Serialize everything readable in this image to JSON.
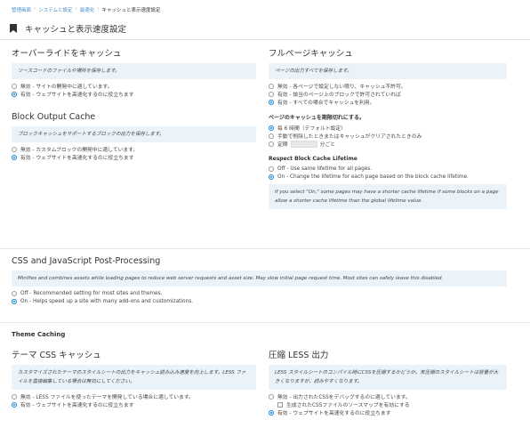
{
  "breadcrumb": {
    "items": [
      "管理画面",
      "システムと設定",
      "最適化"
    ],
    "current": "キャッシュと表示速度設定",
    "separator": "›"
  },
  "header": {
    "title": "キャッシュと表示速度設定",
    "icon": "bookmark-icon"
  },
  "override_cache": {
    "title": "オーバーライドをキャッシュ",
    "help": "ソースコードのファイルや場所を保存します。",
    "options": [
      {
        "label": "無効 - サイトの開発中に適しています。",
        "selected": false
      },
      {
        "label": "有効 - ウェブサイトを高速化するのに役立ちます",
        "selected": true
      }
    ]
  },
  "block_output": {
    "title": "Block Output Cache",
    "help": "ブロックキャッシュをサポートするブロックの出力を保存します。",
    "options": [
      {
        "label": "無効 - カスタムブロックの開発中に適しています。",
        "selected": false
      },
      {
        "label": "有効 - ウェブサイトを高速化するのに役立ちます",
        "selected": true
      }
    ]
  },
  "full_page": {
    "title": "フルページキャッシュ",
    "help": "ページの出力すべてを保存します。",
    "options": [
      {
        "label": "無効 - 各ページで設定しない限り、キャッシュ不許可。",
        "selected": false
      },
      {
        "label": "有効 - 該当のページ上のブロックで許可されていれば",
        "selected": false
      },
      {
        "label": "有効 - すべての場合でキャッシュを利用。",
        "selected": true
      }
    ],
    "expire_title": "ページのキャッシュを期限切れにする。",
    "expire_options": [
      {
        "label": "毎 6 時間（デフォルト設定）",
        "selected": true
      },
      {
        "label": "手動で削除したときまたはキャッシュがクリアされたときのみ",
        "selected": false
      }
    ],
    "expire_custom_prefix": "定期",
    "expire_custom_suffix": "分ごと",
    "lifetime_title": "Respect Block Cache Lifetime",
    "lifetime_options": [
      {
        "label": "Off - Use same lifetime for all pages.",
        "selected": false
      },
      {
        "label": "On - Change the lifetime for each page based on the block cache lifetime.",
        "selected": true
      }
    ],
    "lifetime_help": "If you select \"On,\" some pages may have a shorter cache lifetime if some blocks on a page allow a shorter cache lifetime than the global lifetime value."
  },
  "css_js": {
    "title": "CSS and JavaScript Post-Processing",
    "help": "Minifies and combines assets while loading pages to reduce web server requests and asset size. May slow initial page request time. Most sites can safely leave this disabled.",
    "options": [
      {
        "label": "Off - Recommended setting for most sites and themes.",
        "selected": false
      },
      {
        "label": "On - Helps speed up a site with many add-ons and customizations.",
        "selected": true
      }
    ]
  },
  "theme_caching": {
    "heading": "Theme Caching",
    "theme_css": {
      "title": "テーマ CSS キャッシュ",
      "help": "カスタマイズされたテーマのスタイルシートの出力をキャッシュ読み込み速度を向上します。LESS ファイルを直接編集している場合は無効にしてください。",
      "options": [
        {
          "label": "無効 - LESS ファイルを使ったテーマを開発している場合に適しています。",
          "selected": false
        },
        {
          "label": "有効 - ウェブサイトを高速化するのに役立ちます",
          "selected": true
        }
      ]
    },
    "less": {
      "title": "圧縮 LESS 出力",
      "help": "LESS スタイルシートのコンパイル時にCSSを圧縮するかどうか。未圧縮のスタイルシートは容量が大きくなりますが、読みやすくなります。",
      "options": [
        {
          "label": "無効 - 出力されたCSSをデバッグするのに適しています。",
          "selected": false
        },
        {
          "label": "有効 - ウェブサイトを高速化するのに役立ちます",
          "selected": true
        }
      ],
      "sourcemap_label": "生成されたCSSファイルのソースマップを有効にする"
    }
  }
}
